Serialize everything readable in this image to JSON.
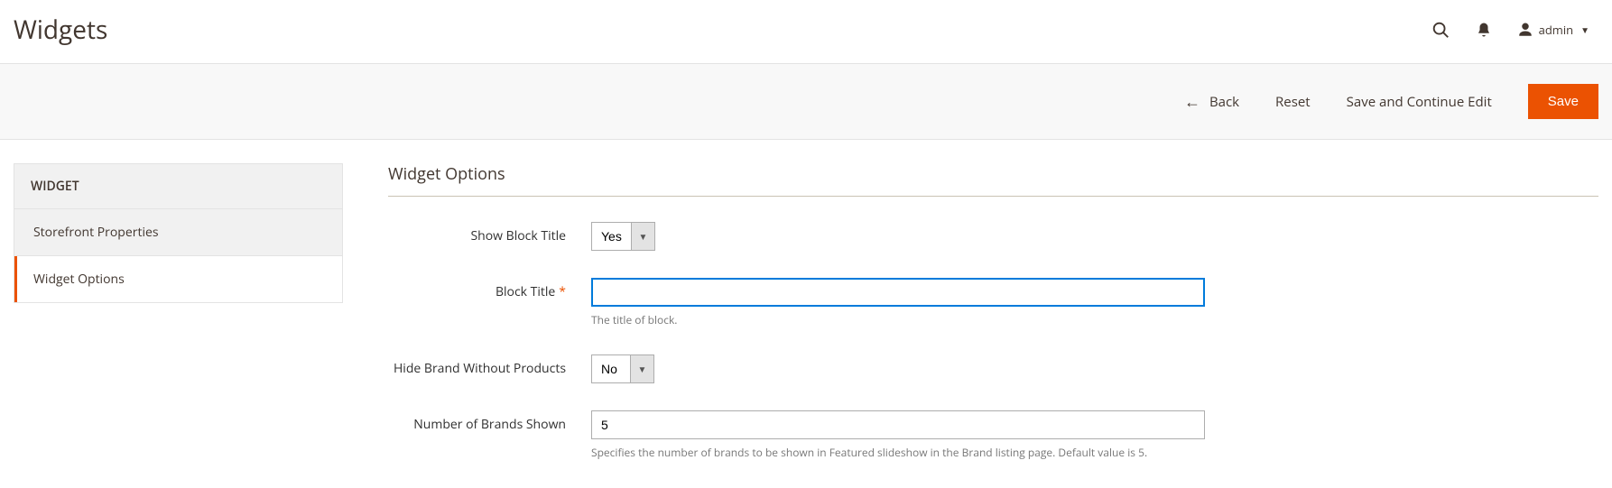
{
  "header": {
    "title": "Widgets",
    "username": "admin"
  },
  "actions": {
    "back": "Back",
    "reset": "Reset",
    "save_continue": "Save and Continue Edit",
    "save": "Save"
  },
  "sidebar": {
    "heading": "WIDGET",
    "tabs": [
      {
        "label": "Storefront Properties",
        "active": false
      },
      {
        "label": "Widget Options",
        "active": true
      }
    ]
  },
  "section": {
    "title": "Widget Options"
  },
  "fields": {
    "show_block_title": {
      "label": "Show Block Title",
      "value": "Yes"
    },
    "block_title": {
      "label": "Block Title",
      "value": "",
      "note": "The title of block."
    },
    "hide_brand_without_products": {
      "label": "Hide Brand Without Products",
      "value": "No"
    },
    "number_of_brands_shown": {
      "label": "Number of Brands Shown",
      "value": "5",
      "note": "Specifies the number of brands to be shown in Featured slideshow in the Brand listing page. Default value is 5."
    }
  }
}
